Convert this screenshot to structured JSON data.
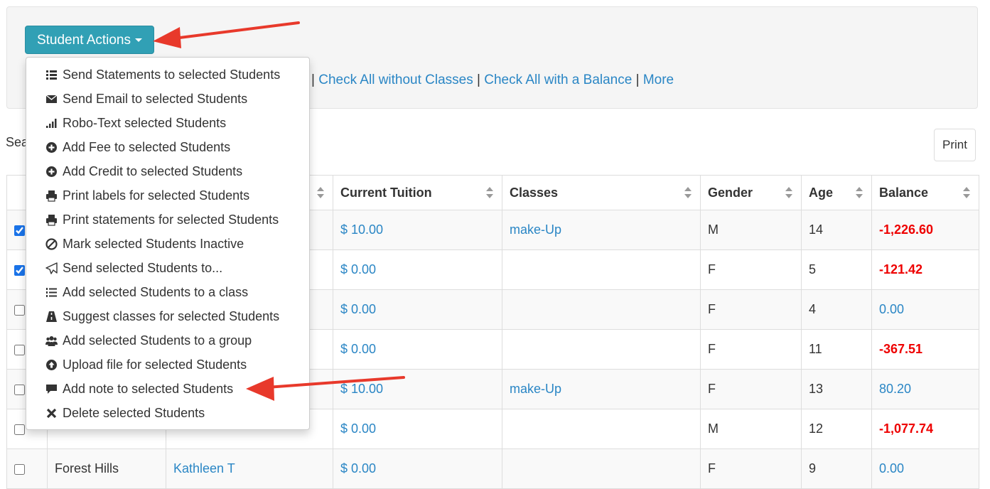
{
  "actions_button": {
    "label": "Student Actions"
  },
  "check_links": {
    "separator": "|",
    "without_classes": "Check All without Classes",
    "with_balance": "Check All with a Balance",
    "more": "More"
  },
  "search": {
    "label_partial": "Sea"
  },
  "print_button": {
    "label": "Print"
  },
  "table": {
    "headers": {
      "current_tuition": "Current Tuition",
      "classes": "Classes",
      "gender": "Gender",
      "age": "Age",
      "balance": "Balance"
    },
    "rows": [
      {
        "checked": true,
        "location": "",
        "student": "",
        "tuition": "$ 10.00",
        "classes": "make-Up",
        "gender": "M",
        "age": "14",
        "balance": "-1,226.60"
      },
      {
        "checked": true,
        "location": "",
        "student": "",
        "tuition": "$ 0.00",
        "classes": "",
        "gender": "F",
        "age": "5",
        "balance": "-121.42"
      },
      {
        "checked": false,
        "location": "",
        "student": "",
        "tuition": "$ 0.00",
        "classes": "",
        "gender": "F",
        "age": "4",
        "balance": "0.00"
      },
      {
        "checked": false,
        "location": "",
        "student": "",
        "tuition": "$ 0.00",
        "classes": "",
        "gender": "F",
        "age": "11",
        "balance": "-367.51"
      },
      {
        "checked": false,
        "location": "",
        "student": "",
        "tuition": "$ 10.00",
        "classes": "make-Up",
        "gender": "F",
        "age": "13",
        "balance": "80.20"
      },
      {
        "checked": false,
        "location": "",
        "student": "",
        "tuition": "$ 0.00",
        "classes": "",
        "gender": "M",
        "age": "12",
        "balance": "-1,077.74"
      },
      {
        "checked": false,
        "location": "Forest Hills",
        "student": "Kathleen T",
        "tuition": "$ 0.00",
        "classes": "",
        "gender": "F",
        "age": "9",
        "balance": "0.00"
      }
    ]
  },
  "menu": {
    "items": [
      {
        "icon": "list-icon",
        "label": "Send Statements to selected Students"
      },
      {
        "icon": "envelope-icon",
        "label": "Send Email to selected Students"
      },
      {
        "icon": "signal-icon",
        "label": "Robo-Text selected Students"
      },
      {
        "icon": "plus-circle-icon",
        "label": "Add Fee to selected Students"
      },
      {
        "icon": "plus-circle-icon",
        "label": "Add Credit to selected Students"
      },
      {
        "icon": "printer-icon",
        "label": "Print labels for selected Students"
      },
      {
        "icon": "printer-icon",
        "label": "Print statements for selected Students"
      },
      {
        "icon": "ban-icon",
        "label": "Mark selected Students Inactive"
      },
      {
        "icon": "paper-plane-icon",
        "label": "Send selected Students to..."
      },
      {
        "icon": "list-ol-icon",
        "label": "Add selected Students to a class"
      },
      {
        "icon": "road-icon",
        "label": "Suggest classes for selected Students"
      },
      {
        "icon": "users-icon",
        "label": "Add selected Students to a group"
      },
      {
        "icon": "upload-icon",
        "label": "Upload file for selected Students"
      },
      {
        "icon": "comment-icon",
        "label": "Add note to selected Students"
      },
      {
        "icon": "times-icon",
        "label": "Delete selected Students"
      }
    ]
  },
  "colors": {
    "button": "#31a0b5",
    "link": "#2a86c5",
    "negative": "#e00000",
    "annotation_arrow": "#e8392b"
  }
}
